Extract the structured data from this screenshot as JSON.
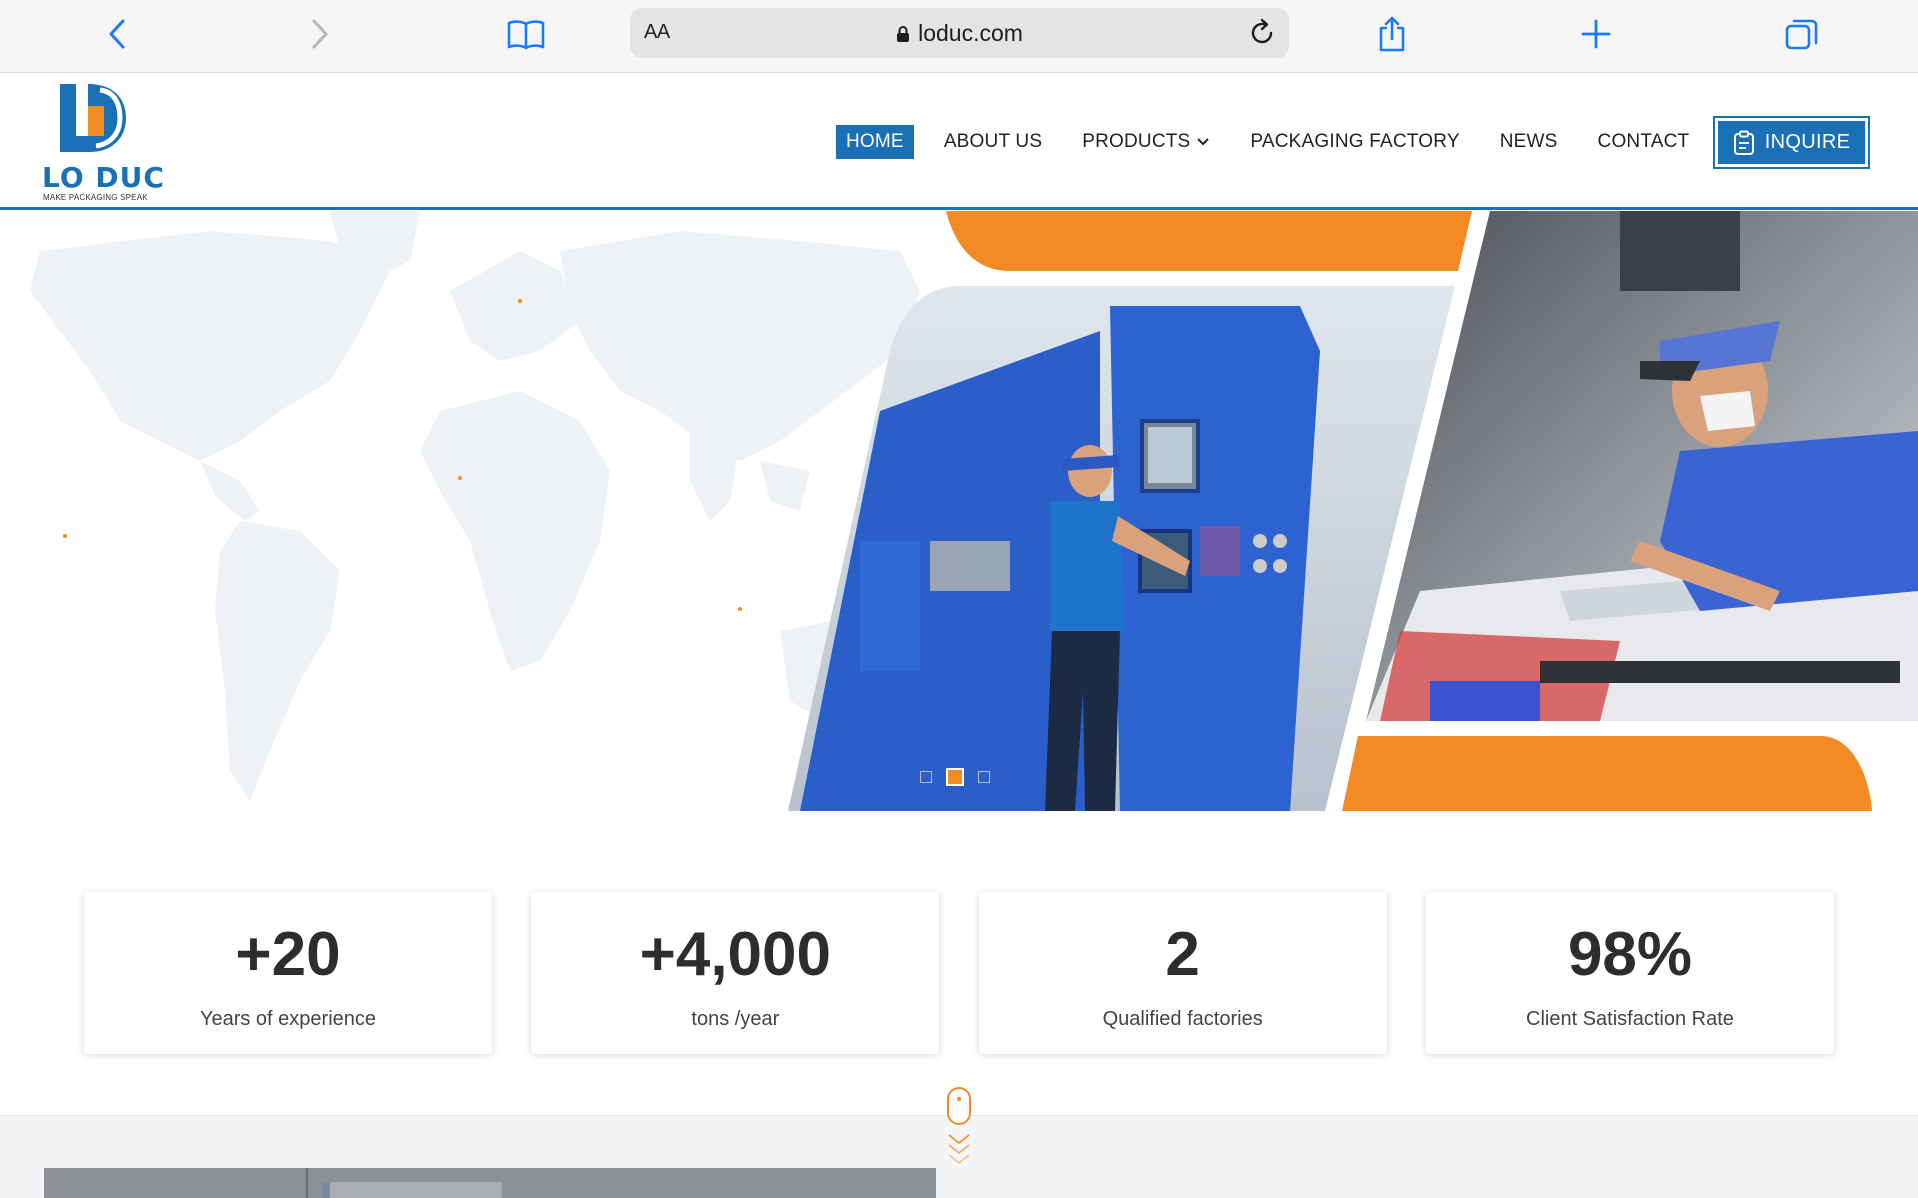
{
  "browser": {
    "aa_label": "AA",
    "url": "loduc.com"
  },
  "logo": {
    "name": "LO DUC",
    "tagline": "MAKE PACKAGING SPEAK"
  },
  "nav": {
    "items": [
      {
        "label": "HOME",
        "active": true
      },
      {
        "label": "ABOUT US"
      },
      {
        "label": "PRODUCTS",
        "has_dropdown": true
      },
      {
        "label": "PACKAGING FACTORY"
      },
      {
        "label": "NEWS"
      },
      {
        "label": "CONTACT"
      }
    ],
    "inquire_label": "INQUIRE"
  },
  "hero": {
    "slides_count": 3,
    "active_slide": 2
  },
  "stats": [
    {
      "value": "+20",
      "label": "Years of experience"
    },
    {
      "value": "+4,000",
      "label": "tons /year"
    },
    {
      "value": "2",
      "label": "Qualified factories"
    },
    {
      "value": "98%",
      "label": "Client Satisfaction Rate"
    }
  ],
  "colors": {
    "brand_blue": "#1b6fb5",
    "accent_orange": "#f28b24",
    "map_tint": "#eef2f7"
  }
}
